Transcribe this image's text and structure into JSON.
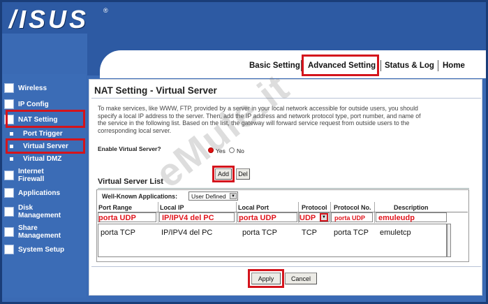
{
  "brand": {
    "logo": "/ISUS",
    "registered": "®"
  },
  "top_menu": {
    "basic": "Basic Setting",
    "advanced": "Advanced Setting",
    "status": "Status & Log",
    "home": "Home"
  },
  "sidebar": {
    "items": [
      {
        "label": "Wireless"
      },
      {
        "label": "IP Config"
      },
      {
        "label": "NAT Setting"
      },
      {
        "label": "Port Trigger"
      },
      {
        "label": "Virtual Server"
      },
      {
        "label": "Virtual DMZ"
      },
      {
        "label": "Internet Firewall"
      },
      {
        "label": "Applications"
      },
      {
        "label": "Disk Management"
      },
      {
        "label": "Share Management"
      },
      {
        "label": "System Setup"
      }
    ]
  },
  "page": {
    "title": "NAT Setting - Virtual Server",
    "description": "To make services, like WWW, FTP, provided by a server in your local network accessible for outside users, you should specify a local IP address to the server. Then, add the IP address and network protocol type, port number, and name of the service in the following list. Based on the list, the gateway will forward service request from outside users to the corresponding local server.",
    "enable_label": "Enable Virtual Server?",
    "yes": "Yes",
    "no": "No",
    "add": "Add",
    "del": "Del",
    "list_title": "Virtual Server List",
    "well_known_label": "Well-Known Applications:",
    "well_known_value": "User Defined",
    "columns": [
      "Port Range",
      "Local IP",
      "Local Port",
      "Protocol",
      "Protocol No.",
      "Description"
    ],
    "input_row": {
      "port_range": "porta UDP",
      "local_ip": "IP/IPV4 del PC",
      "local_port": "porta UDP",
      "protocol": "UDP",
      "protocol_no": "porta UDP",
      "description": "emuleudp"
    },
    "list_row": {
      "port_range": "porta TCP",
      "local_ip": "IP/IPV4 del PC",
      "local_port": "porta TCP",
      "protocol": "TCP",
      "protocol_no": "porta TCP",
      "description": "emuletcp"
    },
    "apply": "Apply",
    "cancel": "Cancel"
  },
  "watermark": "eMule.it",
  "colors": {
    "highlight": "#d4141c",
    "sidebar": "#3b6cb6",
    "header": "#2d5aa3"
  }
}
